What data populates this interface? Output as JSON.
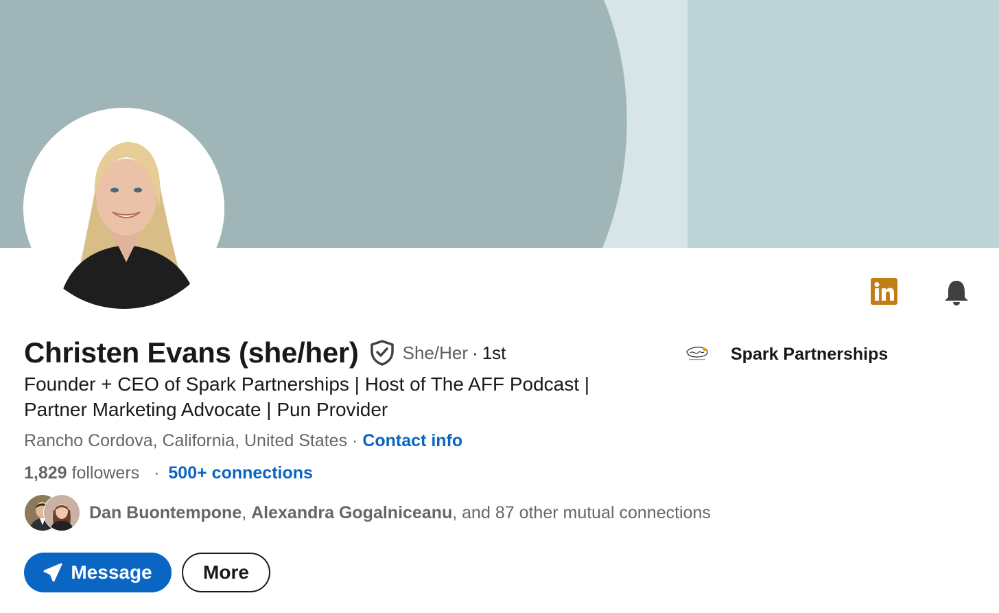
{
  "profile": {
    "name": "Christen Evans (she/her)",
    "pronouns": "She/Her",
    "separator": "·",
    "degree": "1st",
    "headline_line1": "Founder + CEO of Spark Partnerships | Host of The AFF Podcast |",
    "headline_line2": "Partner Marketing Advocate | Pun Provider",
    "location": "Rancho Cordova, California, United States",
    "location_separator": "·",
    "contact_info": "Contact info",
    "followers_count": "1,829",
    "followers_label": "followers",
    "stats_separator": "·",
    "connections": "500+ connections",
    "mutual_name_1": "Dan Buontempone",
    "mutual_comma": ",",
    "mutual_name_2": "Alexandra Gogalniceanu",
    "mutual_rest": ", and 87 other mutual connections"
  },
  "company": {
    "name": "Spark Partnerships"
  },
  "actions": {
    "message_label": "Message",
    "more_label": "More"
  },
  "icons": {
    "linkedin": "linkedin-icon",
    "notifications": "bell-icon",
    "verification": "verified-shield-icon",
    "send": "send-icon"
  },
  "colors": {
    "banner_dark": "#a0b5b7",
    "banner_light": "#bcd4d6",
    "banner_stripe": "#d7e5e6",
    "accent_blue": "#0a66c2",
    "linkedin_badge": "#c37d16",
    "text_primary": "#191919",
    "text_secondary": "#666666"
  }
}
